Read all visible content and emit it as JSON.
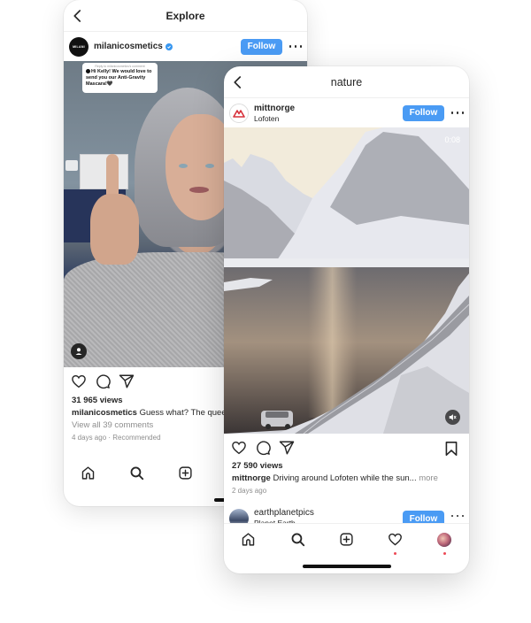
{
  "back_phone": {
    "header": {
      "title": "Explore"
    },
    "post": {
      "username": "milanicosmetics",
      "verified": true,
      "avatar_text": "MILANI",
      "follow_label": "Follow",
      "comment_sticker": {
        "reply_label": "Reply to milanicosmetics's comment",
        "text": "Hi Kelly! We would love to send you our Anti-Gravity Mascara!🖤"
      },
      "views": "31 965 views",
      "caption_user": "milanicosmetics",
      "caption_text": "Guess what? The queen",
      "comments_link": "View all 39 comments",
      "time": "4 days ago",
      "separator": "·",
      "tag": "Recommended"
    },
    "bottom_nav": [
      "home",
      "search",
      "create"
    ]
  },
  "front_phone": {
    "header": {
      "title": "nature"
    },
    "post": {
      "username": "mittnorge",
      "location": "Lofoten",
      "follow_label": "Follow",
      "video_timer": "0:08",
      "views": "27 590 views",
      "caption_user": "mittnorge",
      "caption_text": "Driving around Lofoten while the sun...",
      "more_label": "more",
      "time": "2 days ago"
    },
    "next_post": {
      "username": "earthplanetpics",
      "sublabel": "Planet Earth",
      "follow_label": "Follow"
    },
    "bottom_nav": [
      "home",
      "search",
      "create",
      "activity",
      "profile"
    ],
    "colors": {
      "follow": "#4a9bf4",
      "notification_dot": "#ed4956"
    }
  }
}
